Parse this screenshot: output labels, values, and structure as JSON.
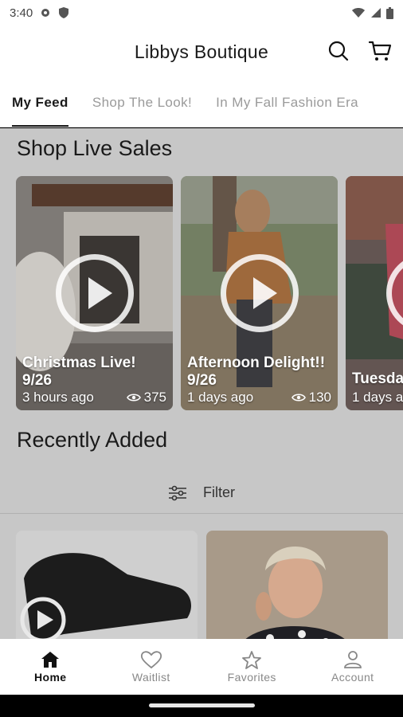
{
  "status_bar": {
    "time": "3:40"
  },
  "app_bar": {
    "title": "Libbys Boutique"
  },
  "tabs": [
    {
      "label": "My Feed",
      "active": true
    },
    {
      "label": "Shop The Look!",
      "active": false
    },
    {
      "label": "In My Fall Fashion Era",
      "active": false
    }
  ],
  "live_sales": {
    "title": "Shop Live Sales",
    "cards": [
      {
        "title": "Christmas Live!\n9/26",
        "time_ago": "3 hours ago",
        "views": "375"
      },
      {
        "title": "Afternoon Delight!!\n9/26",
        "time_ago": "1 days ago",
        "views": "130"
      },
      {
        "title": "Tuesda",
        "time_ago": "1 days a",
        "views": ""
      }
    ]
  },
  "recently_added": {
    "title": "Recently Added",
    "filter_label": "Filter"
  },
  "bottom_nav": [
    {
      "label": "Home",
      "icon": "home-icon",
      "active": true
    },
    {
      "label": "Waitlist",
      "icon": "heart-icon",
      "active": false
    },
    {
      "label": "Favorites",
      "icon": "star-icon",
      "active": false
    },
    {
      "label": "Account",
      "icon": "person-icon",
      "active": false
    }
  ],
  "colors": {
    "accent": "#111111",
    "overlay": "#c7c7c7"
  }
}
